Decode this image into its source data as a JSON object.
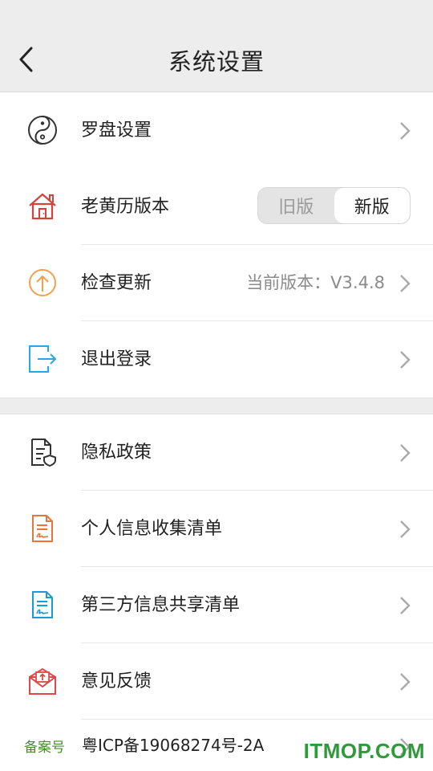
{
  "header": {
    "title": "系统设置"
  },
  "section1": [
    {
      "label": "罗盘设置",
      "icon": "yin-yang-icon"
    },
    {
      "label": "老黄历版本",
      "icon": "house-icon",
      "toggle": {
        "old": "旧版",
        "new": "新版",
        "selected": "新版"
      }
    },
    {
      "label": "检查更新",
      "icon": "upload-circle-icon",
      "value": "当前版本：V3.4.8"
    },
    {
      "label": "退出登录",
      "icon": "logout-icon"
    }
  ],
  "section2": [
    {
      "label": "隐私政策",
      "icon": "document-shield-icon"
    },
    {
      "label": "个人信息收集清单",
      "icon": "orange-document-icon"
    },
    {
      "label": "第三方信息共享清单",
      "icon": "blue-document-icon"
    },
    {
      "label": "意见反馈",
      "icon": "mail-feedback-icon"
    }
  ],
  "footer": {
    "icp_tag": "备案号",
    "icp_number": "粤ICP备19068274号-2A"
  },
  "watermark": "ITMOP.COM",
  "colors": {
    "header_bg": "#ededed",
    "icp_green": "#4c8a2e",
    "watermark_green": "#2f9a3a"
  }
}
